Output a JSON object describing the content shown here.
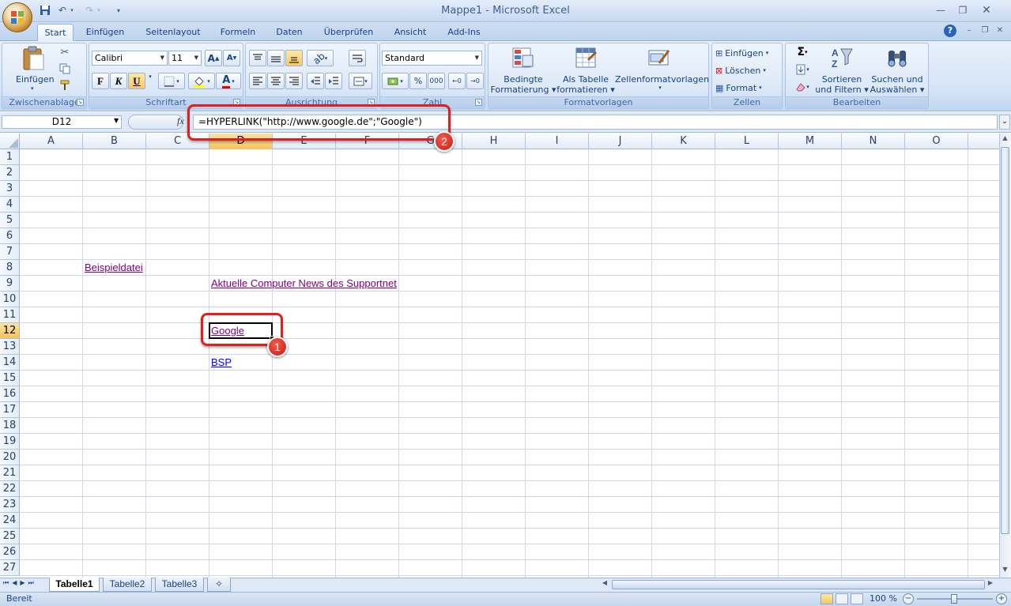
{
  "window": {
    "title": "Mappe1 - Microsoft Excel"
  },
  "quick_access": [
    "save-icon",
    "undo-icon",
    "redo-icon",
    "customize-icon"
  ],
  "ribbon": {
    "tabs": [
      "Start",
      "Einfügen",
      "Seitenlayout",
      "Formeln",
      "Daten",
      "Überprüfen",
      "Ansicht",
      "Add-Ins"
    ],
    "active_tab": "Start",
    "clipboard": {
      "paste_label": "Einfügen",
      "group_label": "Zwischenablage"
    },
    "font": {
      "name": "Calibri",
      "size": "11",
      "bold": "F",
      "italic": "K",
      "underline": "U",
      "group_label": "Schriftart"
    },
    "alignment": {
      "group_label": "Ausrichtung"
    },
    "number": {
      "format": "Standard",
      "percent": "%",
      "thousands": "000",
      "group_label": "Zahl"
    },
    "styles": {
      "conditional_line1": "Bedingte",
      "conditional_line2": "Formatierung",
      "table_line1": "Als Tabelle",
      "table_line2": "formatieren",
      "cellstyles_label": "Zellenformatvorlagen",
      "group_label": "Formatvorlagen"
    },
    "cells": {
      "insert": "Einfügen",
      "delete": "Löschen",
      "format": "Format",
      "group_label": "Zellen"
    },
    "editing": {
      "sort_line1": "Sortieren",
      "sort_line2": "und Filtern",
      "find_line1": "Suchen und",
      "find_line2": "Auswählen",
      "group_label": "Bearbeiten"
    }
  },
  "formula_bar": {
    "name_box": "D12",
    "fx": "fx",
    "formula": "=HYPERLINK(\"http://www.google.de\";\"Google\")"
  },
  "columns": [
    "A",
    "B",
    "C",
    "D",
    "E",
    "F",
    "G",
    "H",
    "I",
    "J",
    "K",
    "L",
    "M",
    "N",
    "O"
  ],
  "selected_column": "D",
  "rows": [
    "1",
    "2",
    "3",
    "4",
    "5",
    "6",
    "7",
    "8",
    "9",
    "10",
    "11",
    "12",
    "13",
    "14",
    "15",
    "16",
    "17",
    "18",
    "19",
    "20",
    "21",
    "22",
    "23",
    "24",
    "25",
    "26",
    "27"
  ],
  "selected_row": "12",
  "cells": {
    "B8": "Beispieldatei",
    "D9": "Aktuelle Computer News des Supportnet",
    "D12": "Google",
    "D14": "BSP"
  },
  "annotations": {
    "badge1": "1",
    "badge2": "2",
    "color": "#e0201c"
  },
  "sheet_tabs": [
    "Tabelle1",
    "Tabelle2",
    "Tabelle3"
  ],
  "active_sheet": "Tabelle1",
  "status": {
    "mode": "Bereit",
    "zoom": "100 %"
  },
  "colors": {
    "visited_link": "#800080",
    "link": "#0000ff",
    "selection_header": "#f7c35d"
  }
}
